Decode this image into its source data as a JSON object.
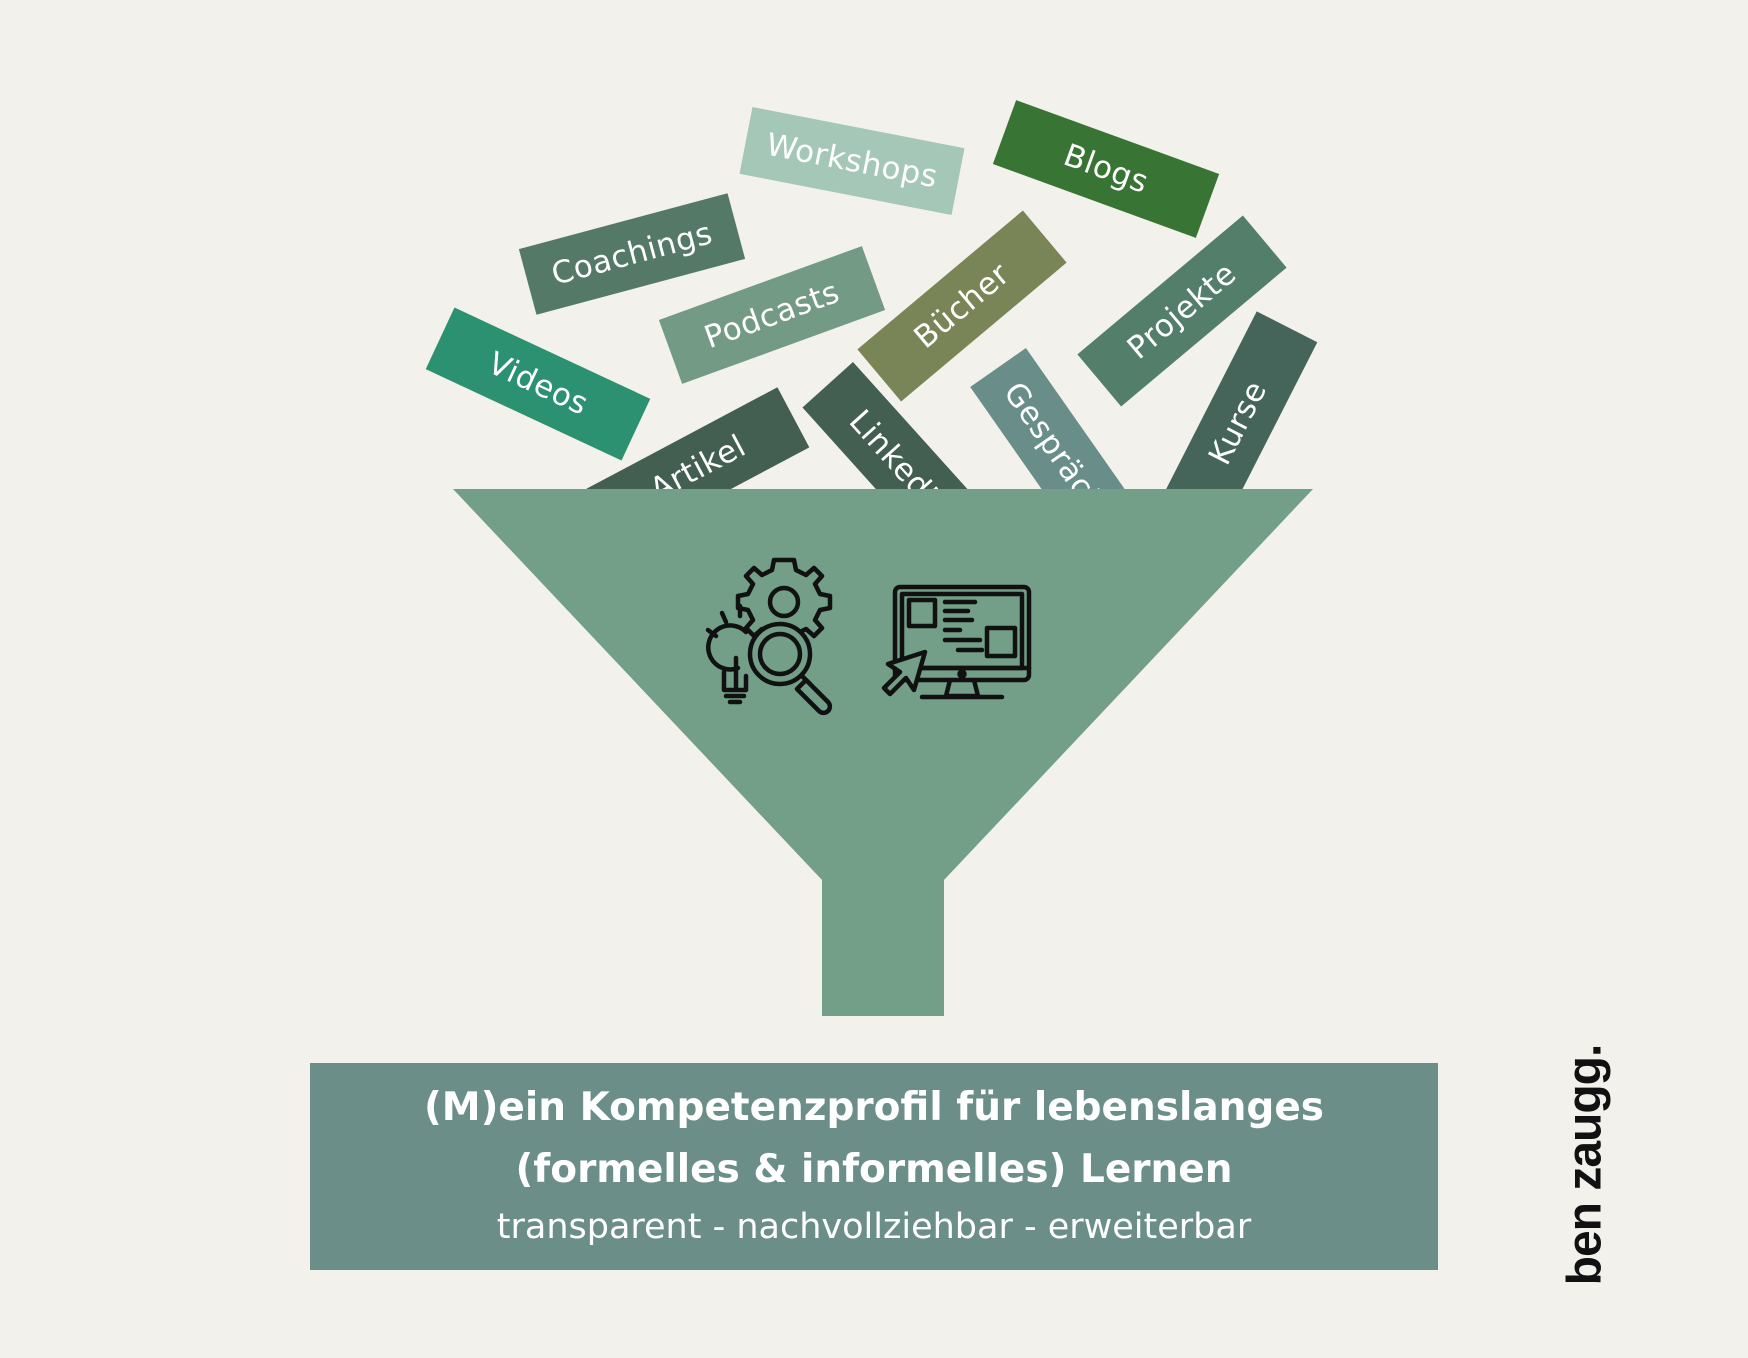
{
  "sources": [
    {
      "label": "Workshops",
      "color": "#a5c7b8"
    },
    {
      "label": "Blogs",
      "color": "#387434"
    },
    {
      "label": "Coachings",
      "color": "#547a67"
    },
    {
      "label": "Podcasts",
      "color": "#739a85"
    },
    {
      "label": "Bücher",
      "color": "#798556"
    },
    {
      "label": "Projekte",
      "color": "#537e6a"
    },
    {
      "label": "Videos",
      "color": "#2c9170"
    },
    {
      "label": "Artikel",
      "color": "#435f52"
    },
    {
      "label": "LinkedIn",
      "color": "#435f52"
    },
    {
      "label": "Gespräche",
      "color": "#698e89"
    },
    {
      "label": "Kurse",
      "color": "#45655a"
    }
  ],
  "funnel": {
    "color": "#739e88",
    "icons": [
      "search-innovation-icon",
      "monitor-click-icon"
    ]
  },
  "caption": {
    "line1": "(M)ein Kompetenzprofil für lebenslanges",
    "line2": "(formelles & informelles) Lernen",
    "subtitle": "transparent - nachvollziehbar - erweiterbar",
    "background": "#6b8f88"
  },
  "brand": "ben zaugg."
}
